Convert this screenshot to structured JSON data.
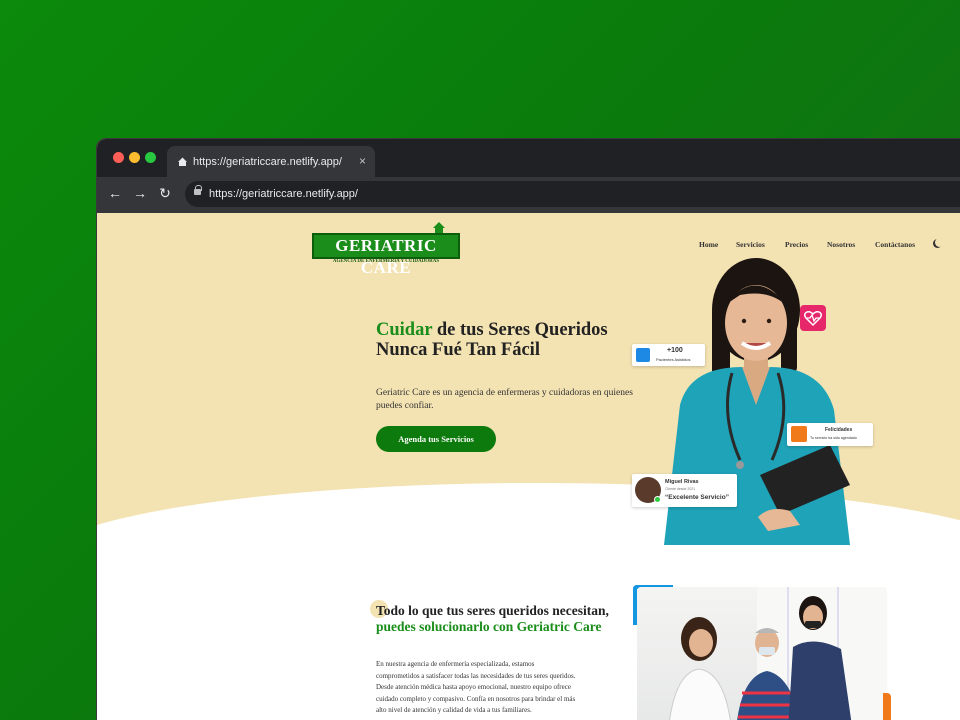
{
  "browser": {
    "tab_title": "https://geriatriccare.netlify.app/",
    "tab_close": "×",
    "url": "https://geriatriccare.netlify.app/",
    "nav": {
      "back": "←",
      "forward": "→",
      "reload": "↻"
    }
  },
  "site": {
    "logo_title": "GERIATRIC CARE",
    "logo_subtitle": "AGENCIA DE ENFERMERÍA Y CUIDADORAS",
    "menu": [
      "Home",
      "Servicios",
      "Precios",
      "Nosotros",
      "Contáctanos"
    ],
    "hero": {
      "title_highlight": "Cuidar",
      "title_rest": " de tus Seres Queridos Nunca Fué Tan Fácil",
      "description": "Geriatric Care es un agencia de enfermeras y cuidadoras en quienes puedes confiar.",
      "cta": "Agenda tus Servicios"
    },
    "cards": {
      "patients_count": "+100",
      "patients_label": "Pacientes Asistidos",
      "congrats_title": "Felicidades",
      "congrats_text": "Tu servicio ha sido agendado",
      "review_name": "Miguel Rivas",
      "review_sub": "Cliente desde 2021",
      "review_text": "“Excelente Servicio”"
    },
    "section2": {
      "title_dark": "Todo lo que tus seres queridos necesitan, ",
      "title_green": "puedes solucionarlo con Geriatric Care",
      "body": "En nuestra agencia de enfermería especializada, estamos comprometidos a satisfacer todas las necesidades de tus seres queridos. Desde atención médica hasta apoyo emocional, nuestro equipo ofrece cuidado completo y compasivo. Confía en nosotros para brindar el más alto nivel de atención y calidad de vida a tus familiares."
    }
  },
  "colors": {
    "brand_green": "#1a8d1a",
    "hero_bg": "#f3e2b2",
    "heart": "#e6286b"
  }
}
